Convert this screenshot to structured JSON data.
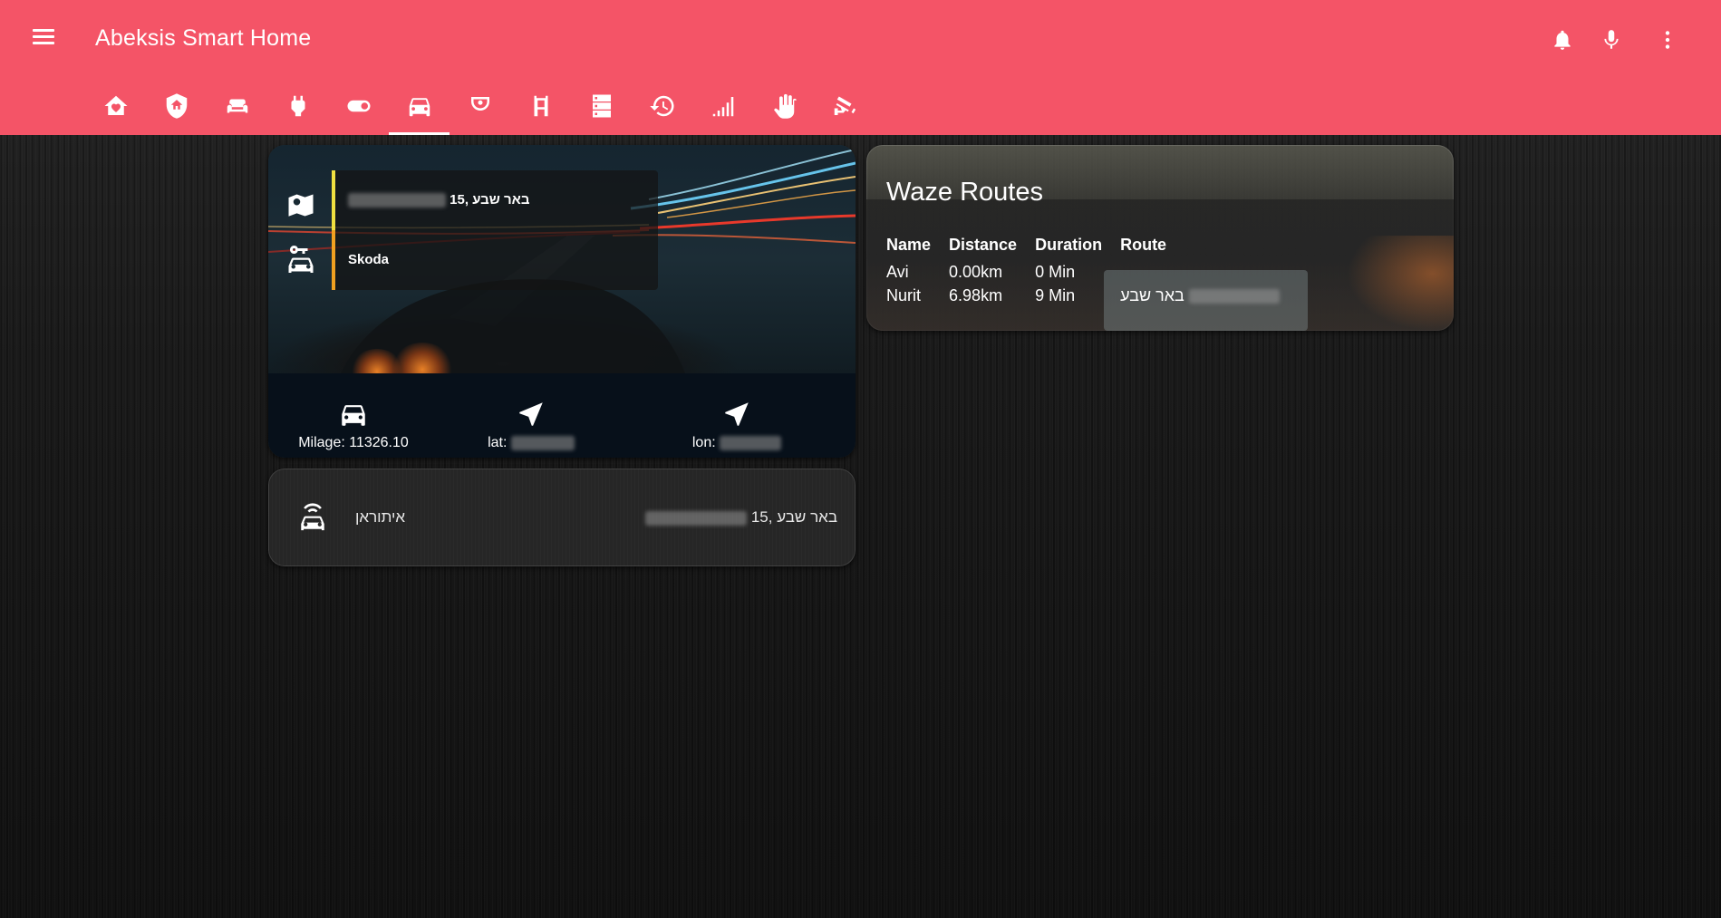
{
  "header": {
    "title": "Abeksis Smart Home",
    "menu_icon": "hamburger-icon",
    "actions": [
      "bell-icon",
      "microphone-icon",
      "more-vertical-icon"
    ],
    "tabs": [
      {
        "icon": "home-heart-icon",
        "active": false
      },
      {
        "icon": "shield-home-icon",
        "active": false
      },
      {
        "icon": "sofa-icon",
        "active": false
      },
      {
        "icon": "power-plug-icon",
        "active": false
      },
      {
        "icon": "toggle-switch-icon",
        "active": false
      },
      {
        "icon": "car-icon",
        "active": true
      },
      {
        "icon": "robot-vacuum-icon",
        "active": false
      },
      {
        "icon": "gate-icon",
        "active": false
      },
      {
        "icon": "server-icon",
        "active": false
      },
      {
        "icon": "clock-restore-icon",
        "active": false
      },
      {
        "icon": "signal-bars-icon",
        "active": false
      },
      {
        "icon": "hand-wave-icon",
        "active": false
      },
      {
        "icon": "cctv-icon",
        "active": false
      }
    ],
    "accent_color": "#f45467"
  },
  "car_card": {
    "address": "באר שבע ,15",
    "vehicle": "Skoda",
    "address_icon": "map-marker-icon",
    "vehicle_icon": "car-key-icon",
    "stats": [
      {
        "icon": "car-icon",
        "label": "Milage: 11326.10"
      },
      {
        "icon": "navigation-icon",
        "label": "lat:"
      },
      {
        "icon": "navigation-icon",
        "label": "lon:"
      }
    ]
  },
  "tracker_card": {
    "icon": "car-connected-icon",
    "name": "איתוראן",
    "state": "באר שבע ,15"
  },
  "waze_card": {
    "title": "Waze Routes",
    "columns": [
      "Name",
      "Distance",
      "Duration",
      "Route"
    ],
    "rows": [
      {
        "name": "Avi",
        "distance": "0.00km",
        "duration": "0 Min",
        "route": ""
      },
      {
        "name": "Nurit",
        "distance": "6.98km",
        "duration": "9 Min",
        "route": "באר שבע"
      }
    ]
  }
}
